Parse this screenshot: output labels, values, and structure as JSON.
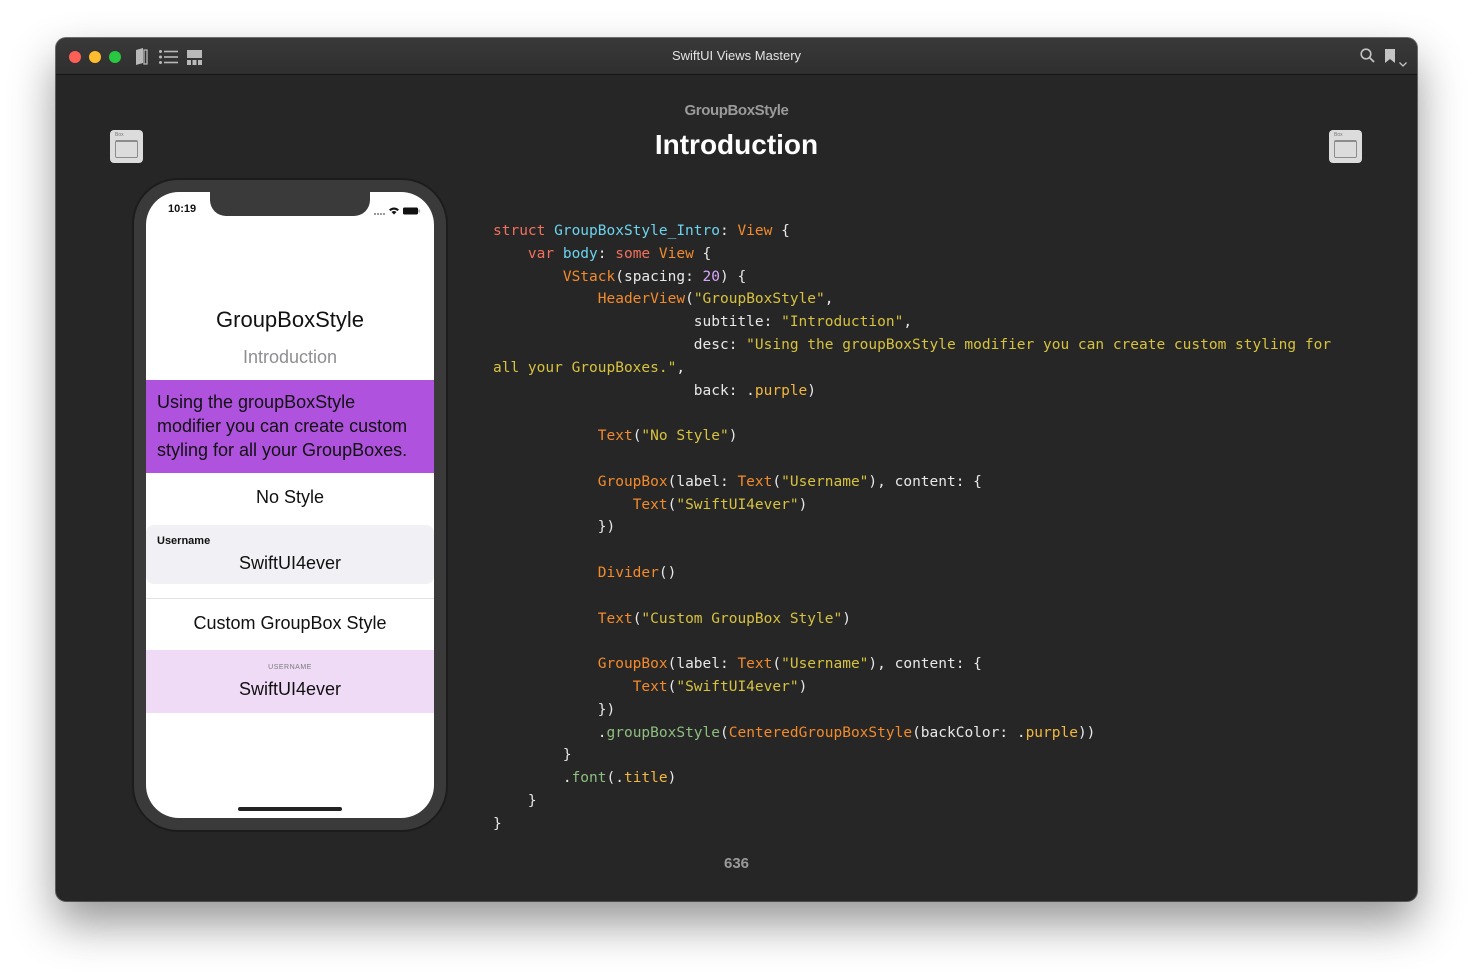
{
  "window": {
    "title": "SwiftUI Views Mastery",
    "icons": [
      "book-icon",
      "list-icon",
      "grid-icon",
      "search-icon",
      "bookmark-icon",
      "chevron-down-icon"
    ]
  },
  "page": {
    "chapter": "GroupBoxStyle",
    "title": "Introduction",
    "page_number": "636",
    "nav_prev_label": "Box",
    "nav_next_label": "Box"
  },
  "phone": {
    "time": "10:19",
    "title": "GroupBoxStyle",
    "subtitle": "Introduction",
    "desc": "Using the groupBoxStyle modifier you can create custom styling for all your GroupBoxes.",
    "desc_color": "#af52de",
    "no_style": "No Style",
    "groupbox1": {
      "label": "Username",
      "content": "SwiftUI4ever"
    },
    "custom_style": "Custom GroupBox Style",
    "groupbox2": {
      "label": "Username",
      "content": "SwiftUI4ever"
    }
  },
  "code_lines": [
    [
      [
        "kw",
        "struct "
      ],
      [
        "ty",
        "GroupBoxStyle_Intro"
      ],
      [
        "p",
        ": "
      ],
      [
        "fn",
        "View"
      ],
      [
        "p",
        " {"
      ]
    ],
    [
      [
        "p",
        "    "
      ],
      [
        "kw",
        "var "
      ],
      [
        "ty",
        "body"
      ],
      [
        "p",
        ": "
      ],
      [
        "kw",
        "some "
      ],
      [
        "fn",
        "View"
      ],
      [
        "p",
        " {"
      ]
    ],
    [
      [
        "p",
        "        "
      ],
      [
        "fn",
        "VStack"
      ],
      [
        "p",
        "(spacing: "
      ],
      [
        "nm",
        "20"
      ],
      [
        "p",
        ") {"
      ]
    ],
    [
      [
        "p",
        "            "
      ],
      [
        "fn",
        "HeaderView"
      ],
      [
        "p",
        "("
      ],
      [
        "st",
        "\"GroupBoxStyle\""
      ],
      [
        "p",
        ","
      ]
    ],
    [
      [
        "p",
        "                       subtitle: "
      ],
      [
        "st",
        "\"Introduction\""
      ],
      [
        "p",
        ","
      ]
    ],
    [
      [
        "p",
        "                       desc: "
      ],
      [
        "st",
        "\"Using the groupBoxStyle modifier you can create custom styling for"
      ]
    ],
    [
      [
        "st",
        "all your GroupBoxes.\""
      ],
      [
        "p",
        ","
      ]
    ],
    [
      [
        "p",
        "                       back: ."
      ],
      [
        "ppl",
        "purple"
      ],
      [
        "p",
        ")"
      ]
    ],
    [
      [
        "p",
        ""
      ]
    ],
    [
      [
        "p",
        "            "
      ],
      [
        "fn",
        "Text"
      ],
      [
        "p",
        "("
      ],
      [
        "st",
        "\"No Style\""
      ],
      [
        "p",
        ")"
      ]
    ],
    [
      [
        "p",
        ""
      ]
    ],
    [
      [
        "p",
        "            "
      ],
      [
        "fn",
        "GroupBox"
      ],
      [
        "p",
        "(label: "
      ],
      [
        "fn",
        "Text"
      ],
      [
        "p",
        "("
      ],
      [
        "st",
        "\"Username\""
      ],
      [
        "p",
        "), content: {"
      ]
    ],
    [
      [
        "p",
        "                "
      ],
      [
        "fn",
        "Text"
      ],
      [
        "p",
        "("
      ],
      [
        "st",
        "\"SwiftUI4ever\""
      ],
      [
        "p",
        ")"
      ]
    ],
    [
      [
        "p",
        "            })"
      ]
    ],
    [
      [
        "p",
        ""
      ]
    ],
    [
      [
        "p",
        "            "
      ],
      [
        "fn",
        "Divider"
      ],
      [
        "p",
        "()"
      ]
    ],
    [
      [
        "p",
        ""
      ]
    ],
    [
      [
        "p",
        "            "
      ],
      [
        "fn",
        "Text"
      ],
      [
        "p",
        "("
      ],
      [
        "st",
        "\"Custom GroupBox Style\""
      ],
      [
        "p",
        ")"
      ]
    ],
    [
      [
        "p",
        ""
      ]
    ],
    [
      [
        "p",
        "            "
      ],
      [
        "fn",
        "GroupBox"
      ],
      [
        "p",
        "(label: "
      ],
      [
        "fn",
        "Text"
      ],
      [
        "p",
        "("
      ],
      [
        "st",
        "\"Username\""
      ],
      [
        "p",
        "), content: {"
      ]
    ],
    [
      [
        "p",
        "                "
      ],
      [
        "fn",
        "Text"
      ],
      [
        "p",
        "("
      ],
      [
        "st",
        "\"SwiftUI4ever\""
      ],
      [
        "p",
        ")"
      ]
    ],
    [
      [
        "p",
        "            })"
      ]
    ],
    [
      [
        "p",
        "            ."
      ],
      [
        "mb",
        "groupBoxStyle"
      ],
      [
        "p",
        "("
      ],
      [
        "fn",
        "CenteredGroupBoxStyle"
      ],
      [
        "p",
        "(backColor: ."
      ],
      [
        "ppl",
        "purple"
      ],
      [
        "p",
        "))"
      ]
    ],
    [
      [
        "p",
        "        }"
      ]
    ],
    [
      [
        "p",
        "        ."
      ],
      [
        "mb",
        "font"
      ],
      [
        "p",
        "(."
      ],
      [
        "ppl",
        "title"
      ],
      [
        "p",
        ")"
      ]
    ],
    [
      [
        "p",
        "    }"
      ]
    ],
    [
      [
        "p",
        "}"
      ]
    ]
  ],
  "colors": {
    "window_bg": "#262626",
    "keyword": "#f2705e",
    "type": "#6cd4ee",
    "function": "#f28b2c",
    "string": "#d7c23e",
    "number": "#d9a6ff",
    "member": "#8fbf80",
    "enum_case": "#f2b83e"
  }
}
